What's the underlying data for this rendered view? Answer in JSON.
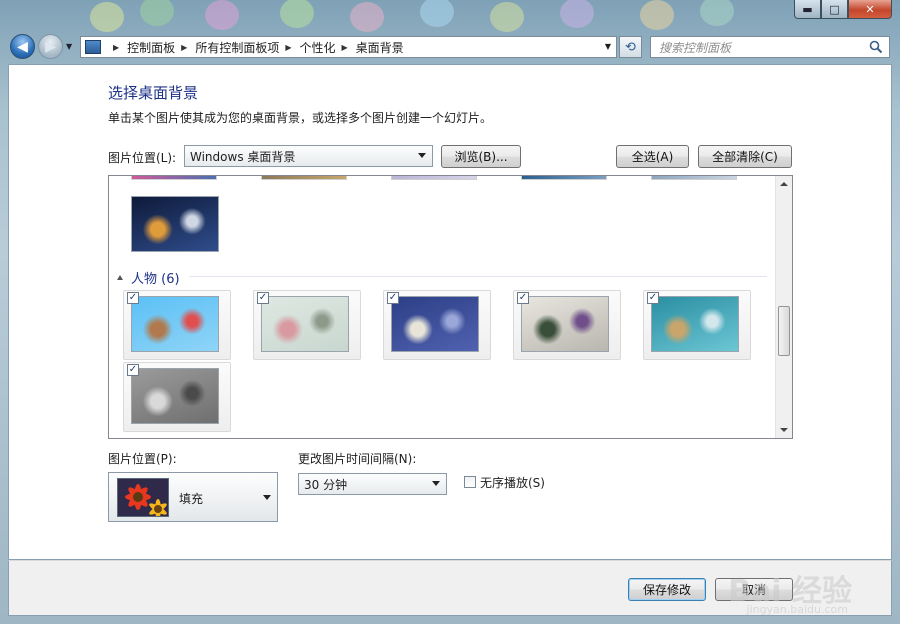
{
  "window": {
    "minimize_icon": "minimize-icon",
    "maximize_icon": "maximize-icon",
    "close_icon": "close-icon",
    "min_glyph": "▬",
    "max_glyph": "□",
    "close_glyph": "✕"
  },
  "nav": {
    "back_glyph": "◀",
    "forward_glyph": "▶",
    "breadcrumbs": [
      "控制面板",
      "所有控制面板项",
      "个性化",
      "桌面背景"
    ],
    "search_placeholder": "搜索控制面板",
    "refresh_glyph": "⟲"
  },
  "page": {
    "title": "选择桌面背景",
    "subtitle": "单击某个图片使其成为您的桌面背景，或选择多个图片创建一个幻灯片。"
  },
  "picture_location": {
    "label": "图片位置(L):",
    "value": "Windows 桌面背景",
    "browse_button": "浏览(B)...",
    "select_all_button": "全选(A)",
    "clear_all_button": "全部清除(C)"
  },
  "gallery": {
    "group_name": "人物 (6)",
    "check_glyph": "✓",
    "items": [
      {
        "name": "people-1",
        "checked": true,
        "colors": [
          "#5bc0f5",
          "#8fd4f7",
          "#b07a4e",
          "#e04e4e"
        ]
      },
      {
        "name": "people-2",
        "checked": true,
        "colors": [
          "#dfe8e2",
          "#c7d7cf",
          "#d89aa0",
          "#8d9a8a"
        ]
      },
      {
        "name": "people-3",
        "checked": true,
        "colors": [
          "#2d3f86",
          "#5061b0",
          "#e8e4d8",
          "#9aa7d8"
        ]
      },
      {
        "name": "people-4",
        "checked": true,
        "colors": [
          "#e8e6df",
          "#b8b6ae",
          "#3a4f3a",
          "#6f4e8a"
        ]
      },
      {
        "name": "people-5",
        "checked": true,
        "colors": [
          "#2a8ea2",
          "#6cc6d4",
          "#c8a56a",
          "#d4e8ec"
        ]
      },
      {
        "name": "people-6",
        "checked": true,
        "colors": [
          "#9b9b9b",
          "#6f6f6f",
          "#d9d9d9",
          "#4a4a4a"
        ]
      }
    ],
    "previous_group_last": {
      "name": "architecture-arc",
      "colors": [
        "#0e1a3a",
        "#2f4d8c",
        "#e09b3a",
        "#cfd6e4"
      ]
    }
  },
  "position": {
    "label": "图片位置(P):",
    "value": "填充"
  },
  "interval": {
    "label": "更改图片时间间隔(N):",
    "value": "30 分钟"
  },
  "shuffle": {
    "label": "无序播放(S)",
    "checked": false
  },
  "footer": {
    "save_button": "保存修改",
    "cancel_button": "取消"
  },
  "watermark": {
    "main": "Bai 经验",
    "sub": "jingyan.baidu.com"
  }
}
